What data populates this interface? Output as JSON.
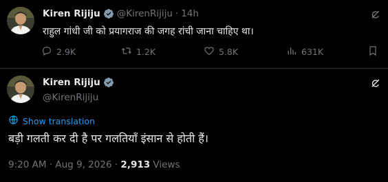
{
  "tweet1": {
    "name": "Kiren Rijiju",
    "handle": "@KirenRijiju",
    "separator": "·",
    "time": "14h",
    "text": "राहुल गांधी जी को प्रयागराज की जगह रांची जाना चाहिए था।",
    "replies": "2.9K",
    "retweets": "1.2K",
    "likes": "5.8K",
    "views": "631K"
  },
  "tweet2": {
    "name": "Kiren Rijiju",
    "handle": "@KirenRijiju",
    "translate_label": "Show translation",
    "text": "बड़ी गलती कर दी है पर गलतियाँ इंसान से होती हैं।",
    "timestamp": "9:20 AM · Aug 9, 2026 · ",
    "views_count": "2,913",
    "views_label": " Views"
  },
  "colors": {
    "background": "#000000",
    "text": "#e7e9ea",
    "muted": "#71767b",
    "accent": "#1d9bf0",
    "divider": "#2f3336"
  },
  "icons": [
    "verified-badge-icon",
    "grok-icon",
    "reply-icon",
    "retweet-icon",
    "like-icon",
    "views-icon",
    "bookmark-icon",
    "globe-icon"
  ]
}
